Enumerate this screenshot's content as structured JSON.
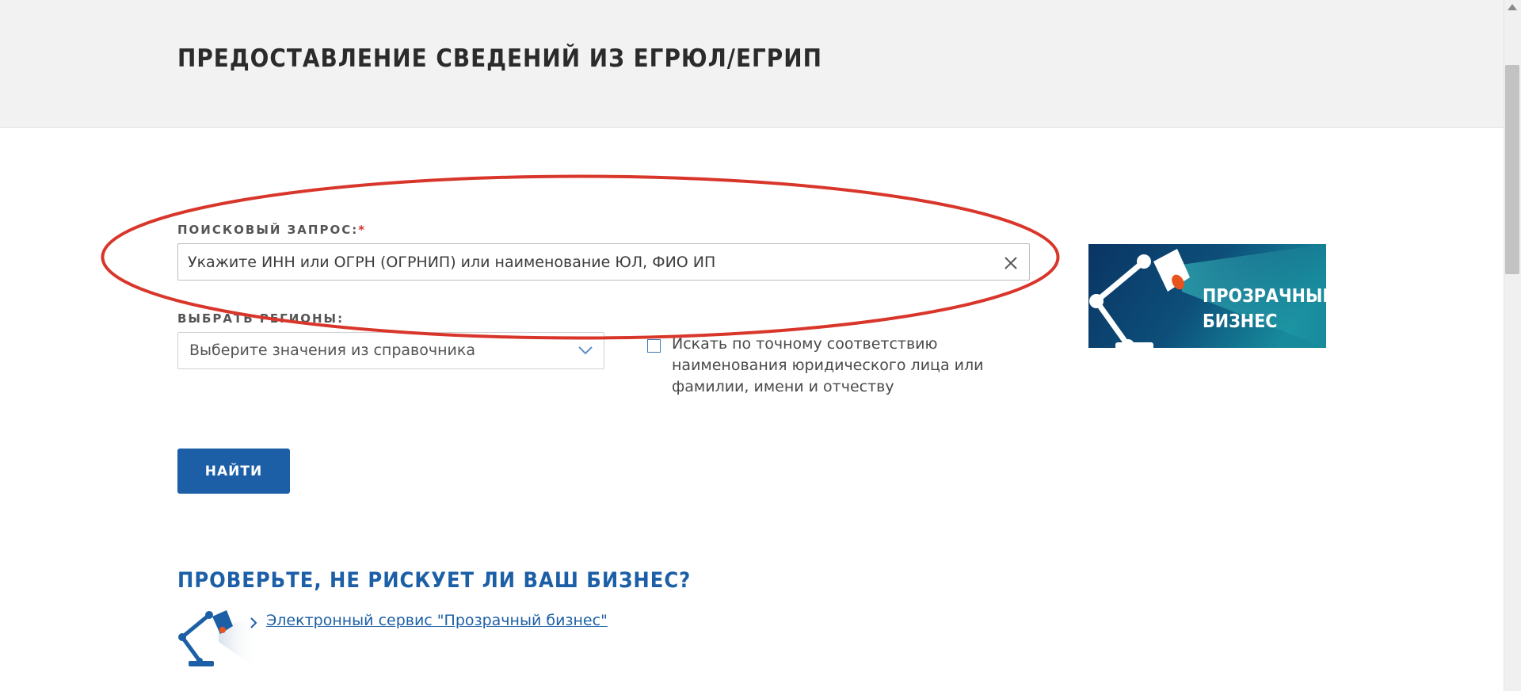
{
  "header": {
    "title": "ПРЕДОСТАВЛЕНИЕ СВЕДЕНИЙ ИЗ ЕГРЮЛ/ЕГРИП"
  },
  "search": {
    "label": "ПОИСКОВЫЙ ЗАПРОС:",
    "required_mark": "*",
    "placeholder": "Укажите ИНН или ОГРН (ОГРНИП) или наименование ЮЛ, ФИО ИП",
    "value": "",
    "clear_icon": "close-icon"
  },
  "regions": {
    "label": "ВЫБРАТЬ РЕГИОНЫ:",
    "selected": "Выберите значения из справочника",
    "icon": "chevron-down-icon"
  },
  "exact_match": {
    "checked": false,
    "label": "Искать по точному соответствию наименования юридического лица или фамилии, имени и отчеству"
  },
  "promo_banner": {
    "line1": "ПРОЗРАЧНЫЙ",
    "line2": "БИЗНЕС",
    "icon": "desk-lamp-icon"
  },
  "submit": {
    "label": "НАЙТИ"
  },
  "business_check": {
    "heading": "ПРОВЕРЬТЕ, НЕ РИСКУЕТ ЛИ ВАШ БИЗНЕС?",
    "link_text": "Электронный сервис \"Прозрачный бизнес\"",
    "icon": "desk-lamp-icon"
  },
  "annotation": {
    "color": "#d9362b",
    "shape": "ellipse"
  },
  "colors": {
    "accent": "#1c5fa6",
    "header_bg": "#f2f2f2",
    "required": "#d0352c",
    "lamp_orange": "#e8541e"
  }
}
